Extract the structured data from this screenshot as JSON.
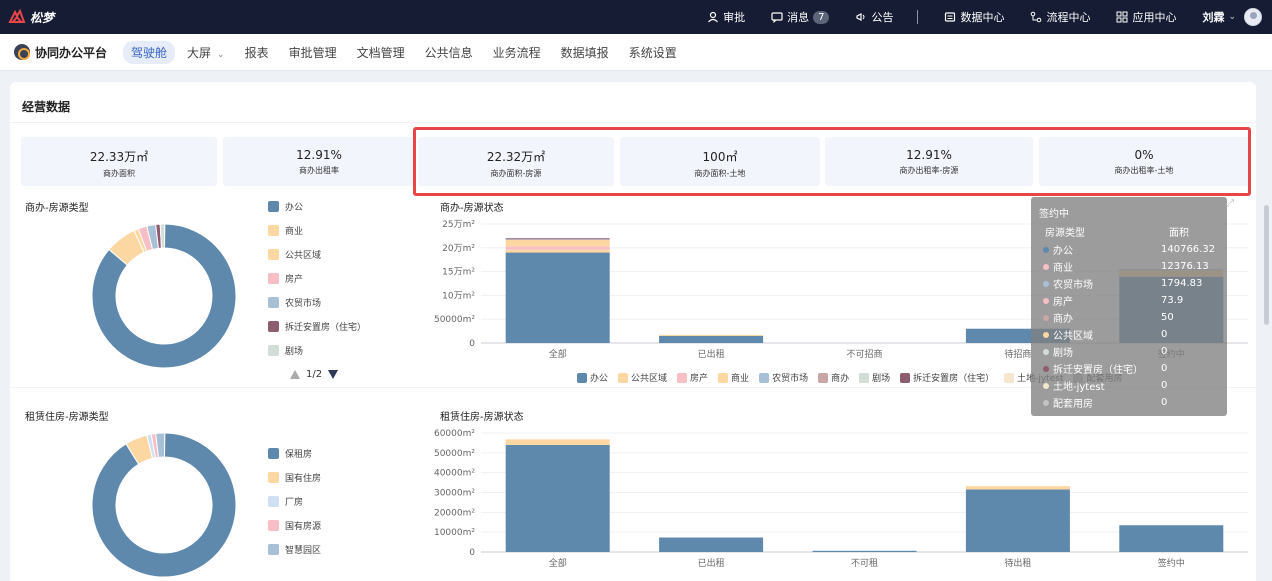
{
  "app": {
    "logo_text": "松梦"
  },
  "topbar": {
    "items": [
      {
        "label": "审批",
        "icon": "person-icon"
      },
      {
        "label": "消息",
        "icon": "message-icon",
        "badge": "7"
      },
      {
        "label": "公告",
        "icon": "megaphone-icon"
      },
      {
        "label": "数据中心",
        "icon": "database-icon"
      },
      {
        "label": "流程中心",
        "icon": "flow-icon"
      },
      {
        "label": "应用中心",
        "icon": "apps-icon"
      }
    ],
    "user_name": "刘霖",
    "user_caret": "⌄"
  },
  "subnav": {
    "brand": "协同办公平台",
    "items": [
      {
        "label": "驾驶舱",
        "active": true
      },
      {
        "label": "大屏",
        "caret": "⌄"
      },
      {
        "label": "报表"
      },
      {
        "label": "审批管理"
      },
      {
        "label": "文档管理"
      },
      {
        "label": "公共信息"
      },
      {
        "label": "业务流程"
      },
      {
        "label": "数据填报"
      },
      {
        "label": "系统设置"
      }
    ]
  },
  "section": {
    "title": "经营数据"
  },
  "kpis": [
    {
      "value": "22.33万㎡",
      "label": "商办面积"
    },
    {
      "value": "12.91%",
      "label": "商办出租率"
    },
    {
      "value": "22.32万㎡",
      "label": "商办面积-房源"
    },
    {
      "value": "100㎡",
      "label": "商办面积-土地"
    },
    {
      "value": "12.91%",
      "label": "商办出租率-房源"
    },
    {
      "value": "0%",
      "label": "商办出租率-土地"
    }
  ],
  "pie1": {
    "title": "商办-房源类型",
    "legend": [
      "办公",
      "商业",
      "公共区域",
      "房产",
      "农贸市场",
      "拆迁安置房（住宅）",
      "剧场"
    ],
    "pager": "1/2"
  },
  "pie2": {
    "title": "租赁住房-房源类型",
    "legend": [
      "保租房",
      "国有住房",
      "厂房",
      "国有房源",
      "智慧园区"
    ]
  },
  "bar1_legend": [
    "办公",
    "公共区域",
    "房产",
    "商业",
    "农贸市场",
    "商办",
    "剧场",
    "拆迁安置房（住宅）",
    "土地-jytest",
    "配套用房"
  ],
  "colors": {
    "办公": "#5e89ad",
    "商业": "#fcd7a1",
    "公共区域": "#fcd7a1",
    "房产": "#f7bfc5",
    "农贸市场": "#a7c0d6",
    "拆迁安置房（住宅）": "#8e5b6f",
    "剧场": "#d3ddd7",
    "商办": "#c8a6a6",
    "土地-jytest": "#f5e6cf",
    "配套用房": "#c2c2c2",
    "保租房": "#5e89ad",
    "国有住房": "#fcd7a1",
    "厂房": "#cfe0f2",
    "国有房源": "#f7bfc5",
    "智慧园区": "#a7c0d6",
    "highlight_border": "#e8454a"
  },
  "tooltip": {
    "title": "签约中",
    "col1": "房源类型",
    "col2": "面积",
    "rows": [
      {
        "label": "办公",
        "value": "140766.32",
        "color": "#5e89ad"
      },
      {
        "label": "商业",
        "value": "12376.13",
        "color": "#f7bfc5"
      },
      {
        "label": "农贸市场",
        "value": "1794.83",
        "color": "#a7c0d6"
      },
      {
        "label": "房产",
        "value": "73.9",
        "color": "#f7bfc5"
      },
      {
        "label": "商办",
        "value": "50",
        "color": "#c8a6a6"
      },
      {
        "label": "公共区域",
        "value": "0",
        "color": "#fcd7a1"
      },
      {
        "label": "剧场",
        "value": "0",
        "color": "#d3ddd7"
      },
      {
        "label": "拆迁安置房（住宅）",
        "value": "0",
        "color": "#8e5b6f"
      },
      {
        "label": "土地-jytest",
        "value": "0",
        "color": "#f5e6cf"
      },
      {
        "label": "配套用房",
        "value": "0",
        "color": "#c2c2c2"
      }
    ]
  },
  "chart_data": [
    {
      "type": "pie",
      "title": "商办-房源类型",
      "categories": [
        "办公",
        "商业",
        "公共区域",
        "房产",
        "农贸市场",
        "拆迁安置房（住宅）",
        "剧场"
      ],
      "values": [
        86,
        7,
        1,
        2,
        2,
        1,
        1
      ]
    },
    {
      "type": "bar",
      "title": "商办-房源状态",
      "categories": [
        "全部",
        "已出租",
        "不可招商",
        "待招商",
        "签约中"
      ],
      "ylim": [
        0,
        250000
      ],
      "yticks": [
        "0",
        "50000m²",
        "10万m²",
        "15万m²",
        "20万m²",
        "25万m²"
      ],
      "series": [
        {
          "name": "办公",
          "values": [
            190000,
            15000,
            0,
            30000,
            140766.32
          ]
        },
        {
          "name": "公共区域",
          "values": [
            6000,
            2000,
            0,
            0,
            0
          ]
        },
        {
          "name": "房产",
          "values": [
            7000,
            0,
            0,
            0,
            73.9
          ]
        },
        {
          "name": "商业",
          "values": [
            14000,
            0,
            0,
            0,
            12376.13
          ]
        },
        {
          "name": "农贸市场",
          "values": [
            2000,
            0,
            0,
            0,
            1794.83
          ]
        },
        {
          "name": "拆迁安置房（住宅）",
          "values": [
            1000,
            0,
            0,
            0,
            0
          ]
        }
      ]
    },
    {
      "type": "pie",
      "title": "租赁住房-房源类型",
      "categories": [
        "保租房",
        "国有住房",
        "厂房",
        "国有房源",
        "智慧园区"
      ],
      "values": [
        91,
        5,
        1,
        1,
        2
      ]
    },
    {
      "type": "bar",
      "title": "租赁住房-房源状态",
      "categories": [
        "全部",
        "已出租",
        "不可租",
        "待出租",
        "签约中"
      ],
      "ylim": [
        0,
        60000
      ],
      "yticks": [
        "0",
        "10000m²",
        "20000m²",
        "30000m²",
        "40000m²",
        "50000m²",
        "60000m²"
      ],
      "series": [
        {
          "name": "保租房",
          "values": [
            54000,
            7300,
            600,
            31500,
            13500
          ]
        },
        {
          "name": "国有住房",
          "values": [
            2800,
            0,
            0,
            1700,
            0
          ]
        }
      ]
    }
  ]
}
